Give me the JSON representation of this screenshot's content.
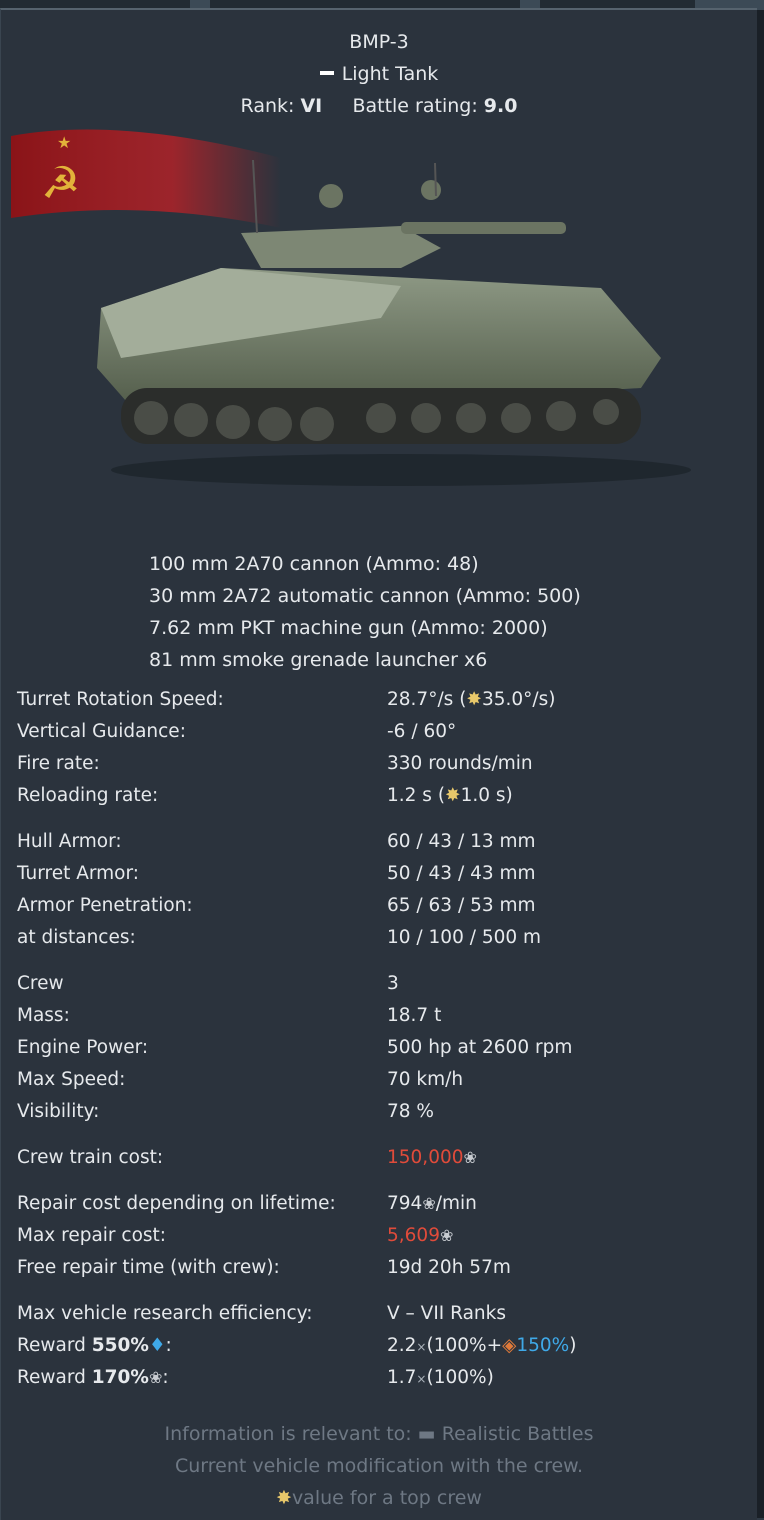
{
  "vehicle": {
    "name": "BMP-3",
    "type": "Light Tank",
    "rank_label": "Rank:",
    "rank": "VI",
    "br_label": "Battle rating:",
    "br": "9.0"
  },
  "weapons": [
    "100 mm 2A70 cannon (Ammo: 48)",
    "30 mm 2A72 automatic cannon (Ammo: 500)",
    "7.62 mm PKT machine gun (Ammo: 2000)",
    "81 mm smoke grenade launcher x6"
  ],
  "stats": {
    "turret_rotation": {
      "label": "Turret Rotation Speed:",
      "value": "28.7°/s (",
      "top": "35.0°/s)"
    },
    "vertical_guidance": {
      "label": "Vertical Guidance:",
      "value": "-6 / 60°"
    },
    "fire_rate": {
      "label": "Fire rate:",
      "value": "330 rounds/min"
    },
    "reloading_rate": {
      "label": "Reloading rate:",
      "value": "1.2 s (",
      "top": "1.0 s)"
    },
    "hull_armor": {
      "label": "Hull Armor:",
      "value": "60 / 43 / 13 mm"
    },
    "turret_armor": {
      "label": "Turret Armor:",
      "value": "50 / 43 / 43 mm"
    },
    "armor_penetration": {
      "label": "Armor Penetration:",
      "value": "65 / 63 / 53 mm"
    },
    "at_distances": {
      "label": "at distances:",
      "value": "10 / 100 / 500 m"
    },
    "crew": {
      "label": "Crew",
      "value": "3"
    },
    "mass": {
      "label": "Mass:",
      "value": "18.7 t"
    },
    "engine_power": {
      "label": "Engine Power:",
      "value": "500 hp at 2600 rpm"
    },
    "max_speed": {
      "label": "Max Speed:",
      "value": "70 km/h"
    },
    "visibility": {
      "label": "Visibility:",
      "value": "78 %"
    },
    "crew_train_cost": {
      "label": "Crew train cost:",
      "value": "150,000"
    },
    "repair_lifetime": {
      "label": "Repair cost depending on lifetime:",
      "value": "794",
      "suffix": "/min"
    },
    "max_repair_cost": {
      "label": "Max repair cost:",
      "value": "5,609"
    },
    "free_repair_time": {
      "label": "Free repair time (with crew):",
      "value": "19d 20h 57m"
    },
    "research_efficiency": {
      "label": "Max vehicle research efficiency:",
      "value": "V – VII Ranks"
    },
    "reward_rp": {
      "label_prefix": "Reward ",
      "label_pct": "550%",
      "value_a": "2.2",
      "value_b": "(100%+",
      "value_bonus": "150%",
      "value_c": ")"
    },
    "reward_sl": {
      "label_prefix": "Reward ",
      "label_pct": "170%",
      "value_a": "1.7",
      "value_b": "(100%)"
    }
  },
  "footer": {
    "line1_a": "Information is relevant to:",
    "line1_b": "Realistic Battles",
    "line2": "Current vehicle modification with the crew.",
    "line3": "value for a top crew"
  },
  "colors": {
    "red_value": "#e04b3a",
    "bonus_blue": "#3fa9e8",
    "top_crew_gold": "#e8c86a"
  },
  "icons": [
    "star-icon",
    "silver-lion-icon",
    "research-point-icon",
    "premium-diamond-icon",
    "battle-mode-icon"
  ]
}
